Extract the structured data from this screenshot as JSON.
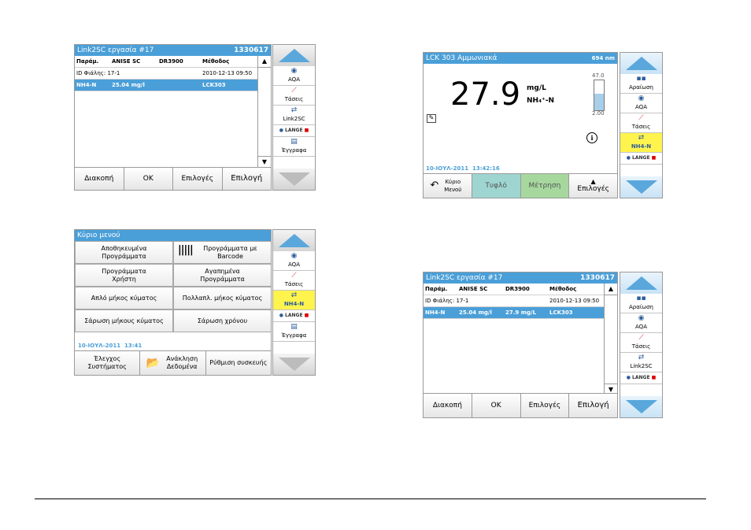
{
  "screen1": {
    "title": "Link2SC εργασία #17",
    "title_right": "1330617",
    "header": {
      "col1": "Παράμ.",
      "col2": "ANISE SC",
      "col3": "DR3900",
      "col4": "Μέθοδος"
    },
    "rows": [
      {
        "c1": "ID Φιάλης: 17-1",
        "c2": "",
        "c3": "",
        "c4": "2010-12-13 09:50"
      },
      {
        "c1": "NH4-N",
        "c2": "25.04 mg/l",
        "c3": "",
        "c4": "LCK303"
      }
    ],
    "buttons": [
      "Διακοπή",
      "OK",
      "Επιλογές",
      "Επιλογή"
    ],
    "sidebar": [
      "AQA",
      "Τάσεις",
      "Link2SC",
      "Έγγραφα"
    ]
  },
  "screen2": {
    "title": "LCK 303 Αμμωνιακά",
    "title_right": "694 nm",
    "value": "27.9",
    "unit": "mg/L",
    "species": "NH₄⁺-N",
    "range_max": "47.0",
    "range_min": "2.00",
    "fill_fraction": 0.55,
    "date": "10-ΙΟΥΛ-2011",
    "time": "13:42:16",
    "buttons": {
      "home": "Κύριο Μενού",
      "blank": "Τυφλό",
      "measure": "Μέτρηση",
      "options": "Επιλογές"
    },
    "sidebar": [
      "Αραίωση",
      "AQA",
      "Τάσεις",
      "NH4-N"
    ]
  },
  "screen3": {
    "title": "Κύριο μενού",
    "cells": [
      "Αποθηκευμένα Προγράμματα",
      "Προγράμματα με Barcode",
      "Προγράμματα Χρήστη",
      "Αγαπημένα Προγράμματα",
      "Απλό μήκος κύματος",
      "Πολλαπλ. μήκος κύματος",
      "Σάρωση μήκους κύματος",
      "Σάρωση χρόνου"
    ],
    "date": "10-ΙΟΥΛ-2011",
    "time": "13:41",
    "buttons": [
      "Έλεγχος Συστήματος",
      "Ανάκληση Δεδομένα",
      "Ρύθμιση συσκευής"
    ],
    "sidebar": [
      "AQA",
      "Τάσεις",
      "NH4-N",
      "Έγγραφα"
    ]
  },
  "screen4": {
    "title": "Link2SC εργασία #17",
    "title_right": "1330617",
    "header": {
      "col1": "Παράμ.",
      "col2": "ANISE SC",
      "col3": "DR3900",
      "col4": "Μέθοδος"
    },
    "rows": [
      {
        "c1": "ID Φιάλης: 17-1",
        "c2": "",
        "c3": "",
        "c4": "2010-12-13 09:50"
      },
      {
        "c1": "NH4-N",
        "c2": "25.04 mg/l",
        "c3": "27.9 mg/L",
        "c4": "LCK303"
      }
    ],
    "buttons": [
      "Διακοπή",
      "OK",
      "Επιλογές",
      "Επιλογή"
    ],
    "sidebar": [
      "Αραίωση",
      "AQA",
      "Τάσεις",
      "Link2SC"
    ]
  },
  "lange": {
    "brand": "LANGE"
  }
}
